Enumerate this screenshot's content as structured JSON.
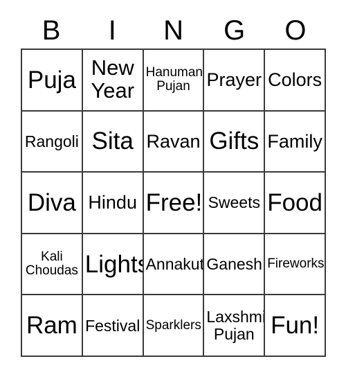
{
  "card": {
    "header_letters": [
      "B",
      "I",
      "N",
      "G",
      "O"
    ],
    "colors": {
      "background": "#ffffff",
      "border": "#3a3a3a",
      "text": "#000000"
    },
    "rows": [
      [
        {
          "label": "Puja",
          "size": "sz-xl"
        },
        {
          "label": "New Year",
          "size": "sz-lg"
        },
        {
          "label": "Hanuman Pujan",
          "size": "sz-xs"
        },
        {
          "label": "Prayer",
          "size": "sz-md"
        },
        {
          "label": "Colors",
          "size": "sz-md"
        }
      ],
      [
        {
          "label": "Rangoli",
          "size": "sz-sm"
        },
        {
          "label": "Sita",
          "size": "sz-xl"
        },
        {
          "label": "Ravan",
          "size": "sz-md"
        },
        {
          "label": "Gifts",
          "size": "sz-xl"
        },
        {
          "label": "Family",
          "size": "sz-md"
        }
      ],
      [
        {
          "label": "Diva",
          "size": "sz-xl"
        },
        {
          "label": "Hindu",
          "size": "sz-md"
        },
        {
          "label": "Free!",
          "size": "sz-xl"
        },
        {
          "label": "Sweets",
          "size": "sz-sm"
        },
        {
          "label": "Food",
          "size": "sz-xl"
        }
      ],
      [
        {
          "label": "Kali Choudas",
          "size": "sz-xs"
        },
        {
          "label": "Lights",
          "size": "sz-xl"
        },
        {
          "label": "Annakut",
          "size": "sz-sm"
        },
        {
          "label": "Ganesh",
          "size": "sz-sm"
        },
        {
          "label": "Fireworks",
          "size": "sz-xs"
        }
      ],
      [
        {
          "label": "Ram",
          "size": "sz-xl"
        },
        {
          "label": "Festival",
          "size": "sz-sm"
        },
        {
          "label": "Sparklers",
          "size": "sz-xs"
        },
        {
          "label": "Laxshmi Pujan",
          "size": "sz-sm"
        },
        {
          "label": "Fun!",
          "size": "sz-xl"
        }
      ]
    ]
  }
}
